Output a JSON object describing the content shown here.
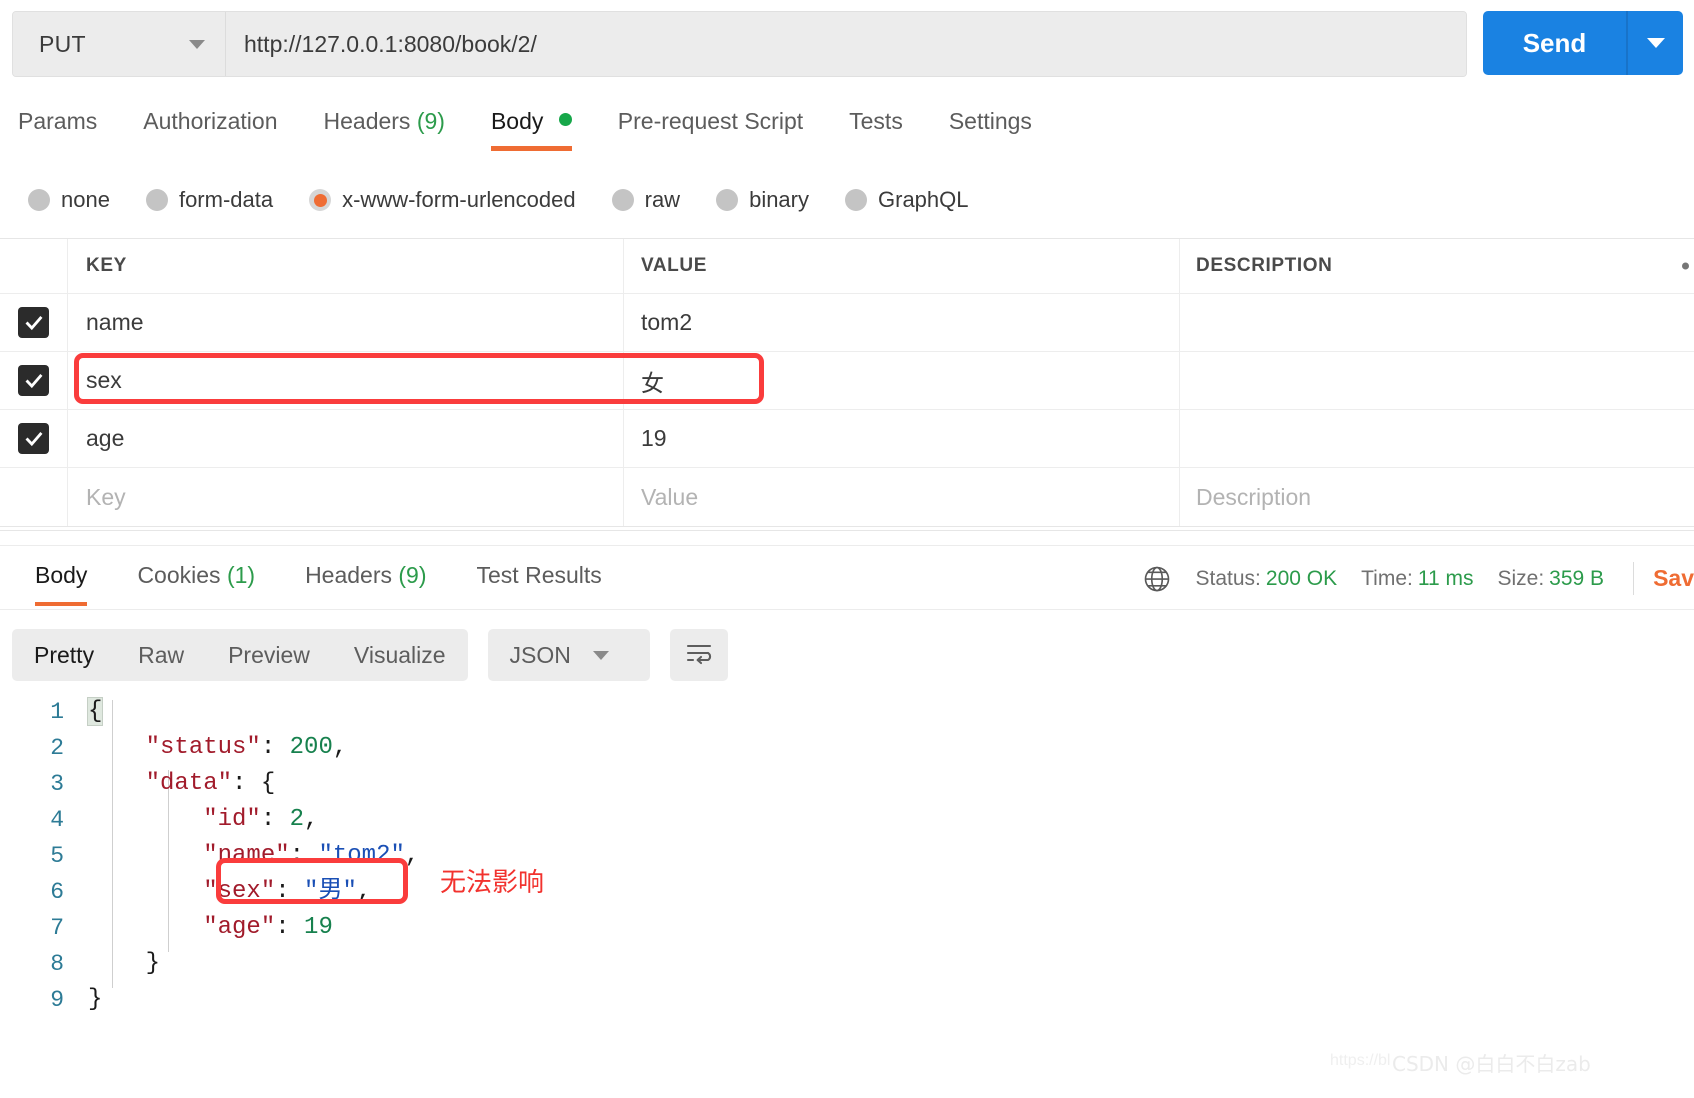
{
  "request": {
    "method": "PUT",
    "url": "http://127.0.0.1:8080/book/2/",
    "send_label": "Send",
    "tabs": [
      {
        "label": "Params",
        "count": "",
        "active": false
      },
      {
        "label": "Authorization",
        "count": "",
        "active": false
      },
      {
        "label": "Headers",
        "count": "(9)",
        "active": false
      },
      {
        "label": "Body",
        "count": "",
        "active": true,
        "dot": true
      },
      {
        "label": "Pre-request Script",
        "count": "",
        "active": false
      },
      {
        "label": "Tests",
        "count": "",
        "active": false
      },
      {
        "label": "Settings",
        "count": "",
        "active": false
      }
    ],
    "body_types": [
      {
        "label": "none",
        "selected": false
      },
      {
        "label": "form-data",
        "selected": false
      },
      {
        "label": "x-www-form-urlencoded",
        "selected": true
      },
      {
        "label": "raw",
        "selected": false
      },
      {
        "label": "binary",
        "selected": false
      },
      {
        "label": "GraphQL",
        "selected": false
      }
    ],
    "table": {
      "columns": [
        "KEY",
        "VALUE",
        "DESCRIPTION"
      ],
      "rows": [
        {
          "checked": true,
          "key": "name",
          "value": "tom2",
          "description": ""
        },
        {
          "checked": true,
          "key": "sex",
          "value": "女",
          "description": "",
          "highlighted": true
        },
        {
          "checked": true,
          "key": "age",
          "value": "19",
          "description": ""
        }
      ],
      "placeholder_row": {
        "key": "Key",
        "value": "Value",
        "description": "Description"
      }
    }
  },
  "response": {
    "tabs": [
      {
        "label": "Body",
        "count": "",
        "active": true
      },
      {
        "label": "Cookies",
        "count": "(1)",
        "active": false
      },
      {
        "label": "Headers",
        "count": "(9)",
        "active": false
      },
      {
        "label": "Test Results",
        "count": "",
        "active": false
      }
    ],
    "status_label": "Status:",
    "status_value": "200 OK",
    "time_label": "Time:",
    "time_value": "11 ms",
    "size_label": "Size:",
    "size_value": "359 B",
    "save_label": "Sav",
    "format_tabs": [
      {
        "label": "Pretty",
        "active": true
      },
      {
        "label": "Raw",
        "active": false
      },
      {
        "label": "Preview",
        "active": false
      },
      {
        "label": "Visualize",
        "active": false
      }
    ],
    "format_select": "JSON",
    "body_lines": [
      {
        "n": "1",
        "text": "{"
      },
      {
        "n": "2",
        "text": "    \"status\": 200,"
      },
      {
        "n": "3",
        "text": "    \"data\": {"
      },
      {
        "n": "4",
        "text": "        \"id\": 2,"
      },
      {
        "n": "5",
        "text": "        \"name\": \"tom2\","
      },
      {
        "n": "6",
        "text": "        \"sex\": \"男\","
      },
      {
        "n": "7",
        "text": "        \"age\": 19"
      },
      {
        "n": "8",
        "text": "    }"
      },
      {
        "n": "9",
        "text": "}"
      }
    ]
  },
  "annotations": {
    "json_note": "无法影响"
  },
  "watermark": {
    "url": "https://bl",
    "credit": "CSDN @白白不白zab"
  },
  "colors": {
    "accent_orange": "#ef6c33",
    "send_blue": "#1a82e2",
    "success_green": "#2c9b4b",
    "annotation_red": "#fa3c3c"
  }
}
